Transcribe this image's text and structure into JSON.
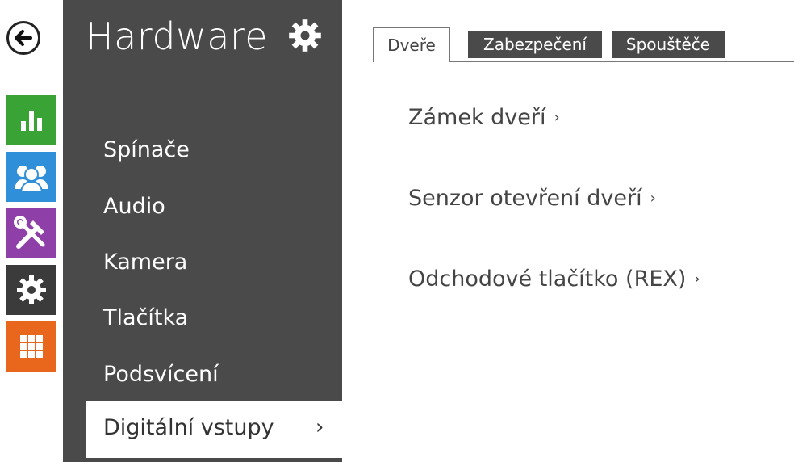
{
  "rail": {
    "back_icon": "back-arrow-icon",
    "tiles": [
      {
        "name": "status",
        "icon": "bar-chart-icon",
        "color": "#3aa335"
      },
      {
        "name": "directory",
        "icon": "users-icon",
        "color": "#2f8fd8"
      },
      {
        "name": "services",
        "icon": "tools-icon",
        "color": "#8e3fa8"
      },
      {
        "name": "hardware",
        "icon": "gear-icon",
        "color": "#3b3b3b"
      },
      {
        "name": "system",
        "icon": "grid-icon",
        "color": "#e8671c"
      }
    ]
  },
  "sidebar": {
    "title": "Hardware",
    "items": [
      {
        "label": "Spínače"
      },
      {
        "label": "Audio"
      },
      {
        "label": "Kamera"
      },
      {
        "label": "Tlačítka"
      },
      {
        "label": "Podsvícení"
      },
      {
        "label": "Digitální vstupy",
        "chevron": "›",
        "active": true
      }
    ]
  },
  "tabs": [
    {
      "label": "Dveře",
      "active": true
    },
    {
      "label": "Zabezpečení",
      "active": false
    },
    {
      "label": "Spouštěče",
      "active": false
    }
  ],
  "content": {
    "links": [
      {
        "label": "Zámek dveří",
        "chevron": "›"
      },
      {
        "label": "Senzor otevření dveří",
        "chevron": "›"
      },
      {
        "label": "Odchodové tlačítko (REX)",
        "chevron": "›"
      }
    ]
  },
  "colors": {
    "sidebar_bg": "#4a4a4a",
    "accent_status": "#3aa335",
    "accent_directory": "#2f8fd8",
    "accent_services": "#8e3fa8",
    "accent_system": "#e8671c"
  }
}
